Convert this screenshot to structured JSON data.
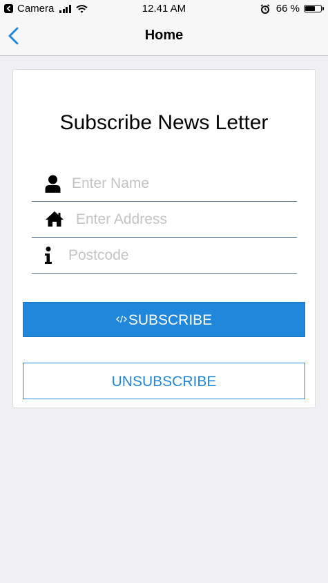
{
  "status_bar": {
    "back_app": "Camera",
    "time": "12.41 AM",
    "battery_percent": "66 %",
    "battery_level": 0.66
  },
  "nav": {
    "title": "Home",
    "back_icon": "chevron-left-icon"
  },
  "form": {
    "title": "Subscribe News Letter",
    "fields": [
      {
        "placeholder": "Enter Name",
        "value": "",
        "icon": "user-icon"
      },
      {
        "placeholder": "Enter Address",
        "value": "",
        "icon": "home-icon"
      },
      {
        "placeholder": "Postcode",
        "value": "",
        "icon": "info-icon"
      }
    ],
    "subscribe_label": "SUBSCRIBE",
    "unsubscribe_label": "UNSUBSCRIBE"
  },
  "colors": {
    "accent": "#2187db",
    "background": "#efeff4",
    "field_border": "#4a6a8a"
  }
}
